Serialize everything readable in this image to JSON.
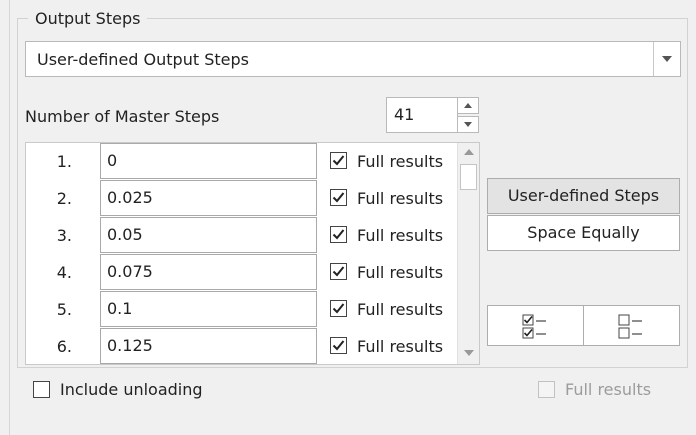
{
  "group": {
    "title": "Output Steps"
  },
  "dropdown": {
    "selected": "User-defined Output Steps",
    "icon": "chevron-down-icon"
  },
  "master_steps": {
    "label": "Number of Master Steps",
    "value": "41"
  },
  "steps": [
    {
      "num": "1.",
      "value": "0",
      "full_label": "Full results",
      "checked": true
    },
    {
      "num": "2.",
      "value": "0.025",
      "full_label": "Full results",
      "checked": true
    },
    {
      "num": "3.",
      "value": "0.05",
      "full_label": "Full results",
      "checked": true
    },
    {
      "num": "4.",
      "value": "0.075",
      "full_label": "Full results",
      "checked": true
    },
    {
      "num": "5.",
      "value": "0.1",
      "full_label": "Full results",
      "checked": true
    },
    {
      "num": "6.",
      "value": "0.125",
      "full_label": "Full results",
      "checked": true
    }
  ],
  "buttons": {
    "user_defined": "User-defined Steps",
    "space_equally": "Space Equally",
    "check_all_icon": "check-all-icon",
    "uncheck_all_icon": "uncheck-all-icon"
  },
  "include_unloading": {
    "label": "Include unloading",
    "checked": false
  },
  "footer_full_results": {
    "label": "Full results",
    "checked": false,
    "disabled": true
  }
}
